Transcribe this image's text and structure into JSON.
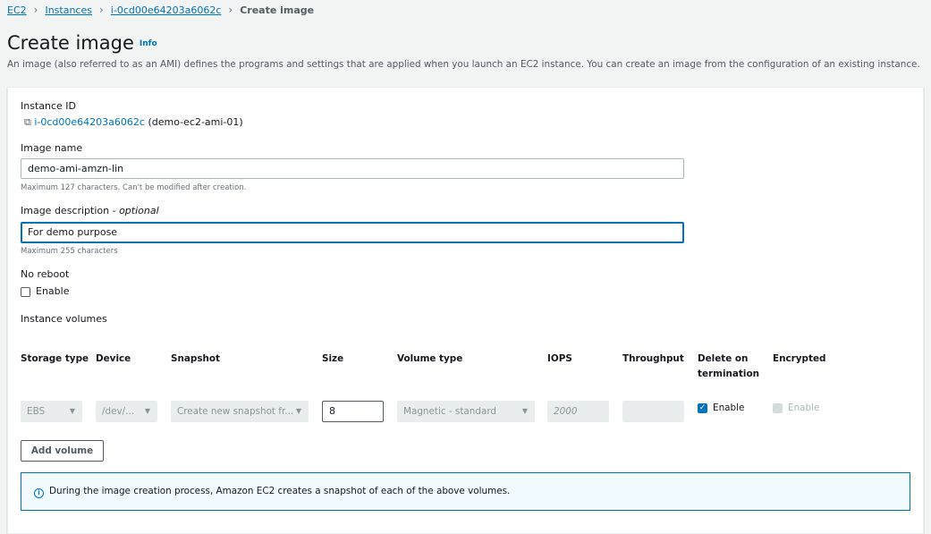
{
  "breadcrumb": [
    {
      "label": "EC2"
    },
    {
      "label": "Instances"
    },
    {
      "label": "i-0cd00e64203a6062c"
    },
    {
      "label": "Create image"
    }
  ],
  "header": {
    "title": "Create image",
    "info": "Info",
    "description": "An image (also referred to as an AMI) defines the programs and settings that are applied when you launch an EC2 instance. You can create an image from the configuration of an existing instance."
  },
  "form": {
    "instance_id_label": "Instance ID",
    "instance_id": "i-0cd00e64203a6062c",
    "instance_name": "(demo-ec2-ami-01)",
    "image_name_label": "Image name",
    "image_name_value": "demo-ami-amzn-lin",
    "image_name_hint": "Maximum 127 characters. Can't be modified after creation.",
    "image_desc_label": "Image description",
    "image_desc_optional": "- optional",
    "image_desc_value": "For demo purpose",
    "image_desc_hint": "Maximum 255 characters",
    "no_reboot_label": "No reboot",
    "no_reboot_enable": "Enable",
    "no_reboot_checked": false
  },
  "volumes": {
    "title": "Instance volumes",
    "headers": [
      "Storage type",
      "Device",
      "Snapshot",
      "Size",
      "Volume type",
      "IOPS",
      "Throughput",
      "Delete on termination",
      "Encrypted"
    ],
    "row": {
      "storage_type": "EBS",
      "device": "/dev/...",
      "snapshot": "Create new snapshot fr...",
      "size": "8",
      "volume_type": "Magnetic - standard",
      "iops": "2000",
      "throughput": "",
      "delete_on_termination": "Enable",
      "delete_checked": true,
      "encrypted": "Enable",
      "encrypted_checked": false
    },
    "add_volume": "Add volume",
    "alert": "During the image creation process, Amazon EC2 creates a snapshot of each of the above volumes."
  }
}
